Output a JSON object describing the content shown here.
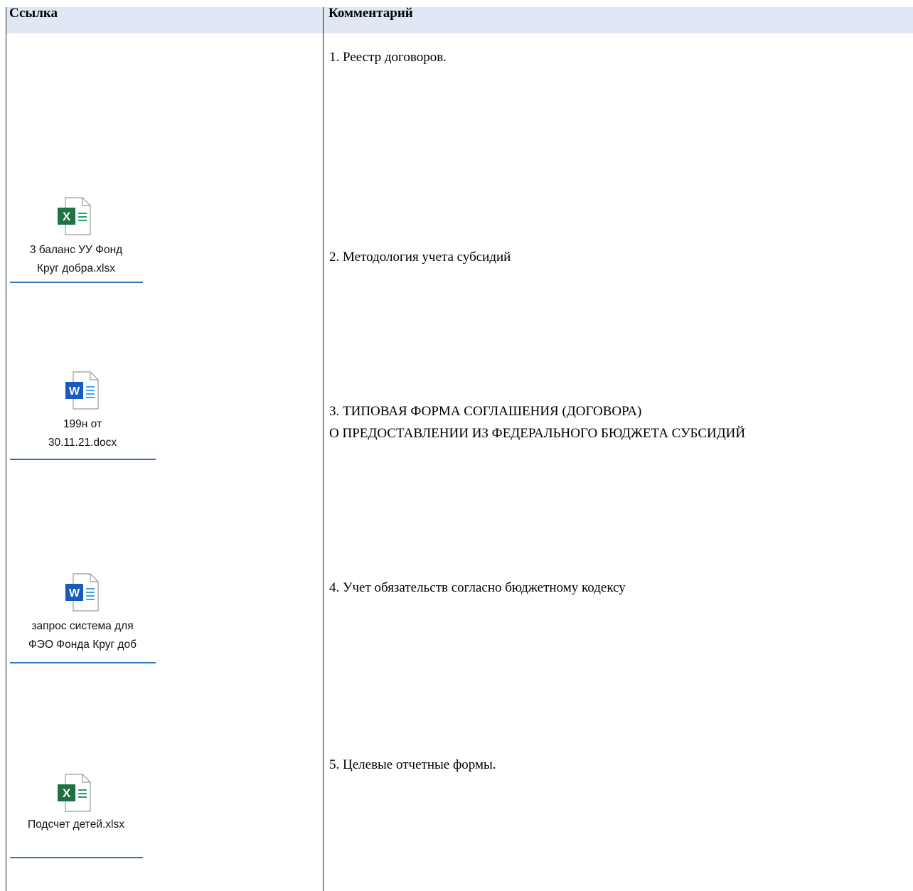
{
  "table": {
    "headers": {
      "link": "Ссылка",
      "comment": "Комментарий"
    },
    "rows": [
      {
        "attachment": {
          "type": "excel-icon",
          "line1": "3 баланс УУ Фонд",
          "line2": "Круг добра.xlsx"
        },
        "comment": [
          "1. Реестр договоров.",
          "2. Методология учета субсидий"
        ]
      },
      {
        "attachment": {
          "type": "word-icon",
          "line1": "199н от",
          "line2": "30.11.21.docx"
        },
        "comment": [
          "3. ТИПОВАЯ ФОРМА СОГЛАШЕНИЯ (ДОГОВОРА)",
          "О ПРЕДОСТАВЛЕНИИ ИЗ ФЕДЕРАЛЬНОГО БЮДЖЕТА СУБСИДИЙ"
        ]
      },
      {
        "attachment": {
          "type": "word-icon",
          "line1": "запрос система для",
          "line2": "ФЭО Фонда Круг доб"
        },
        "comment": [
          "4. Учет обязательств согласно бюджетному кодексу"
        ]
      },
      {
        "attachment": {
          "type": "excel-icon",
          "line1": "Подсчет детей.xlsx"
        },
        "comment": [
          "5. Целевые отчетные формы."
        ]
      }
    ]
  },
  "colors": {
    "header_bg": "#dfe8f4",
    "link_underline": "#2e75b6",
    "excel_green": "#1f7244",
    "word_blue": "#185abd"
  }
}
